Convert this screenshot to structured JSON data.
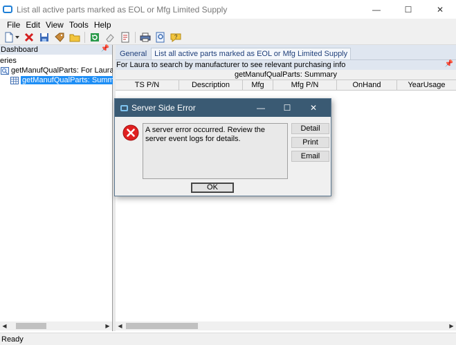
{
  "window": {
    "title": "List all active parts marked as EOL or Mfg Limited Supply",
    "minimize": "—",
    "maximize": "☐",
    "close": "✕"
  },
  "menu": {
    "items": [
      "File",
      "Edit",
      "View",
      "Tools",
      "Help"
    ]
  },
  "toolbar": {
    "icons": [
      "new-icon",
      "dropdown-arrow-icon",
      "delete-icon",
      "save-icon",
      "tag-icon",
      "folder-icon",
      "refresh-icon",
      "eraser-icon",
      "document-icon",
      "print-icon",
      "preview-icon",
      "help-icon"
    ]
  },
  "left_panel": {
    "header": "Dashboard",
    "tree": {
      "root": "eries",
      "query": "getManufQualParts: For Laura to",
      "summary": "getManufQualParts: Summar"
    }
  },
  "tabs": {
    "general": "General",
    "active": "List all active parts marked as EOL or Mfg Limited Supply"
  },
  "info_bar": "For Laura to search by manufacturer to see relevant purchasing info",
  "grid": {
    "title": "getManufQualParts: Summary",
    "columns": [
      "TS P/N",
      "Description",
      "Mfg",
      "Mfg P/N",
      "OnHand",
      "YearUsage"
    ]
  },
  "dialog": {
    "title": "Server Side Error",
    "message": "A server error occurred. Review the server event logs for details.",
    "buttons": {
      "detail": "Detail",
      "print": "Print",
      "email": "Email",
      "ok": "OK"
    },
    "minimize": "—",
    "maximize": "☐",
    "close": "✕"
  },
  "status": "Ready",
  "colors": {
    "dialog_title_bg": "#3a5a73",
    "selection": "#1e8ef5",
    "panel_header_bg": "#dfe6f0",
    "error_red": "#e02020"
  }
}
